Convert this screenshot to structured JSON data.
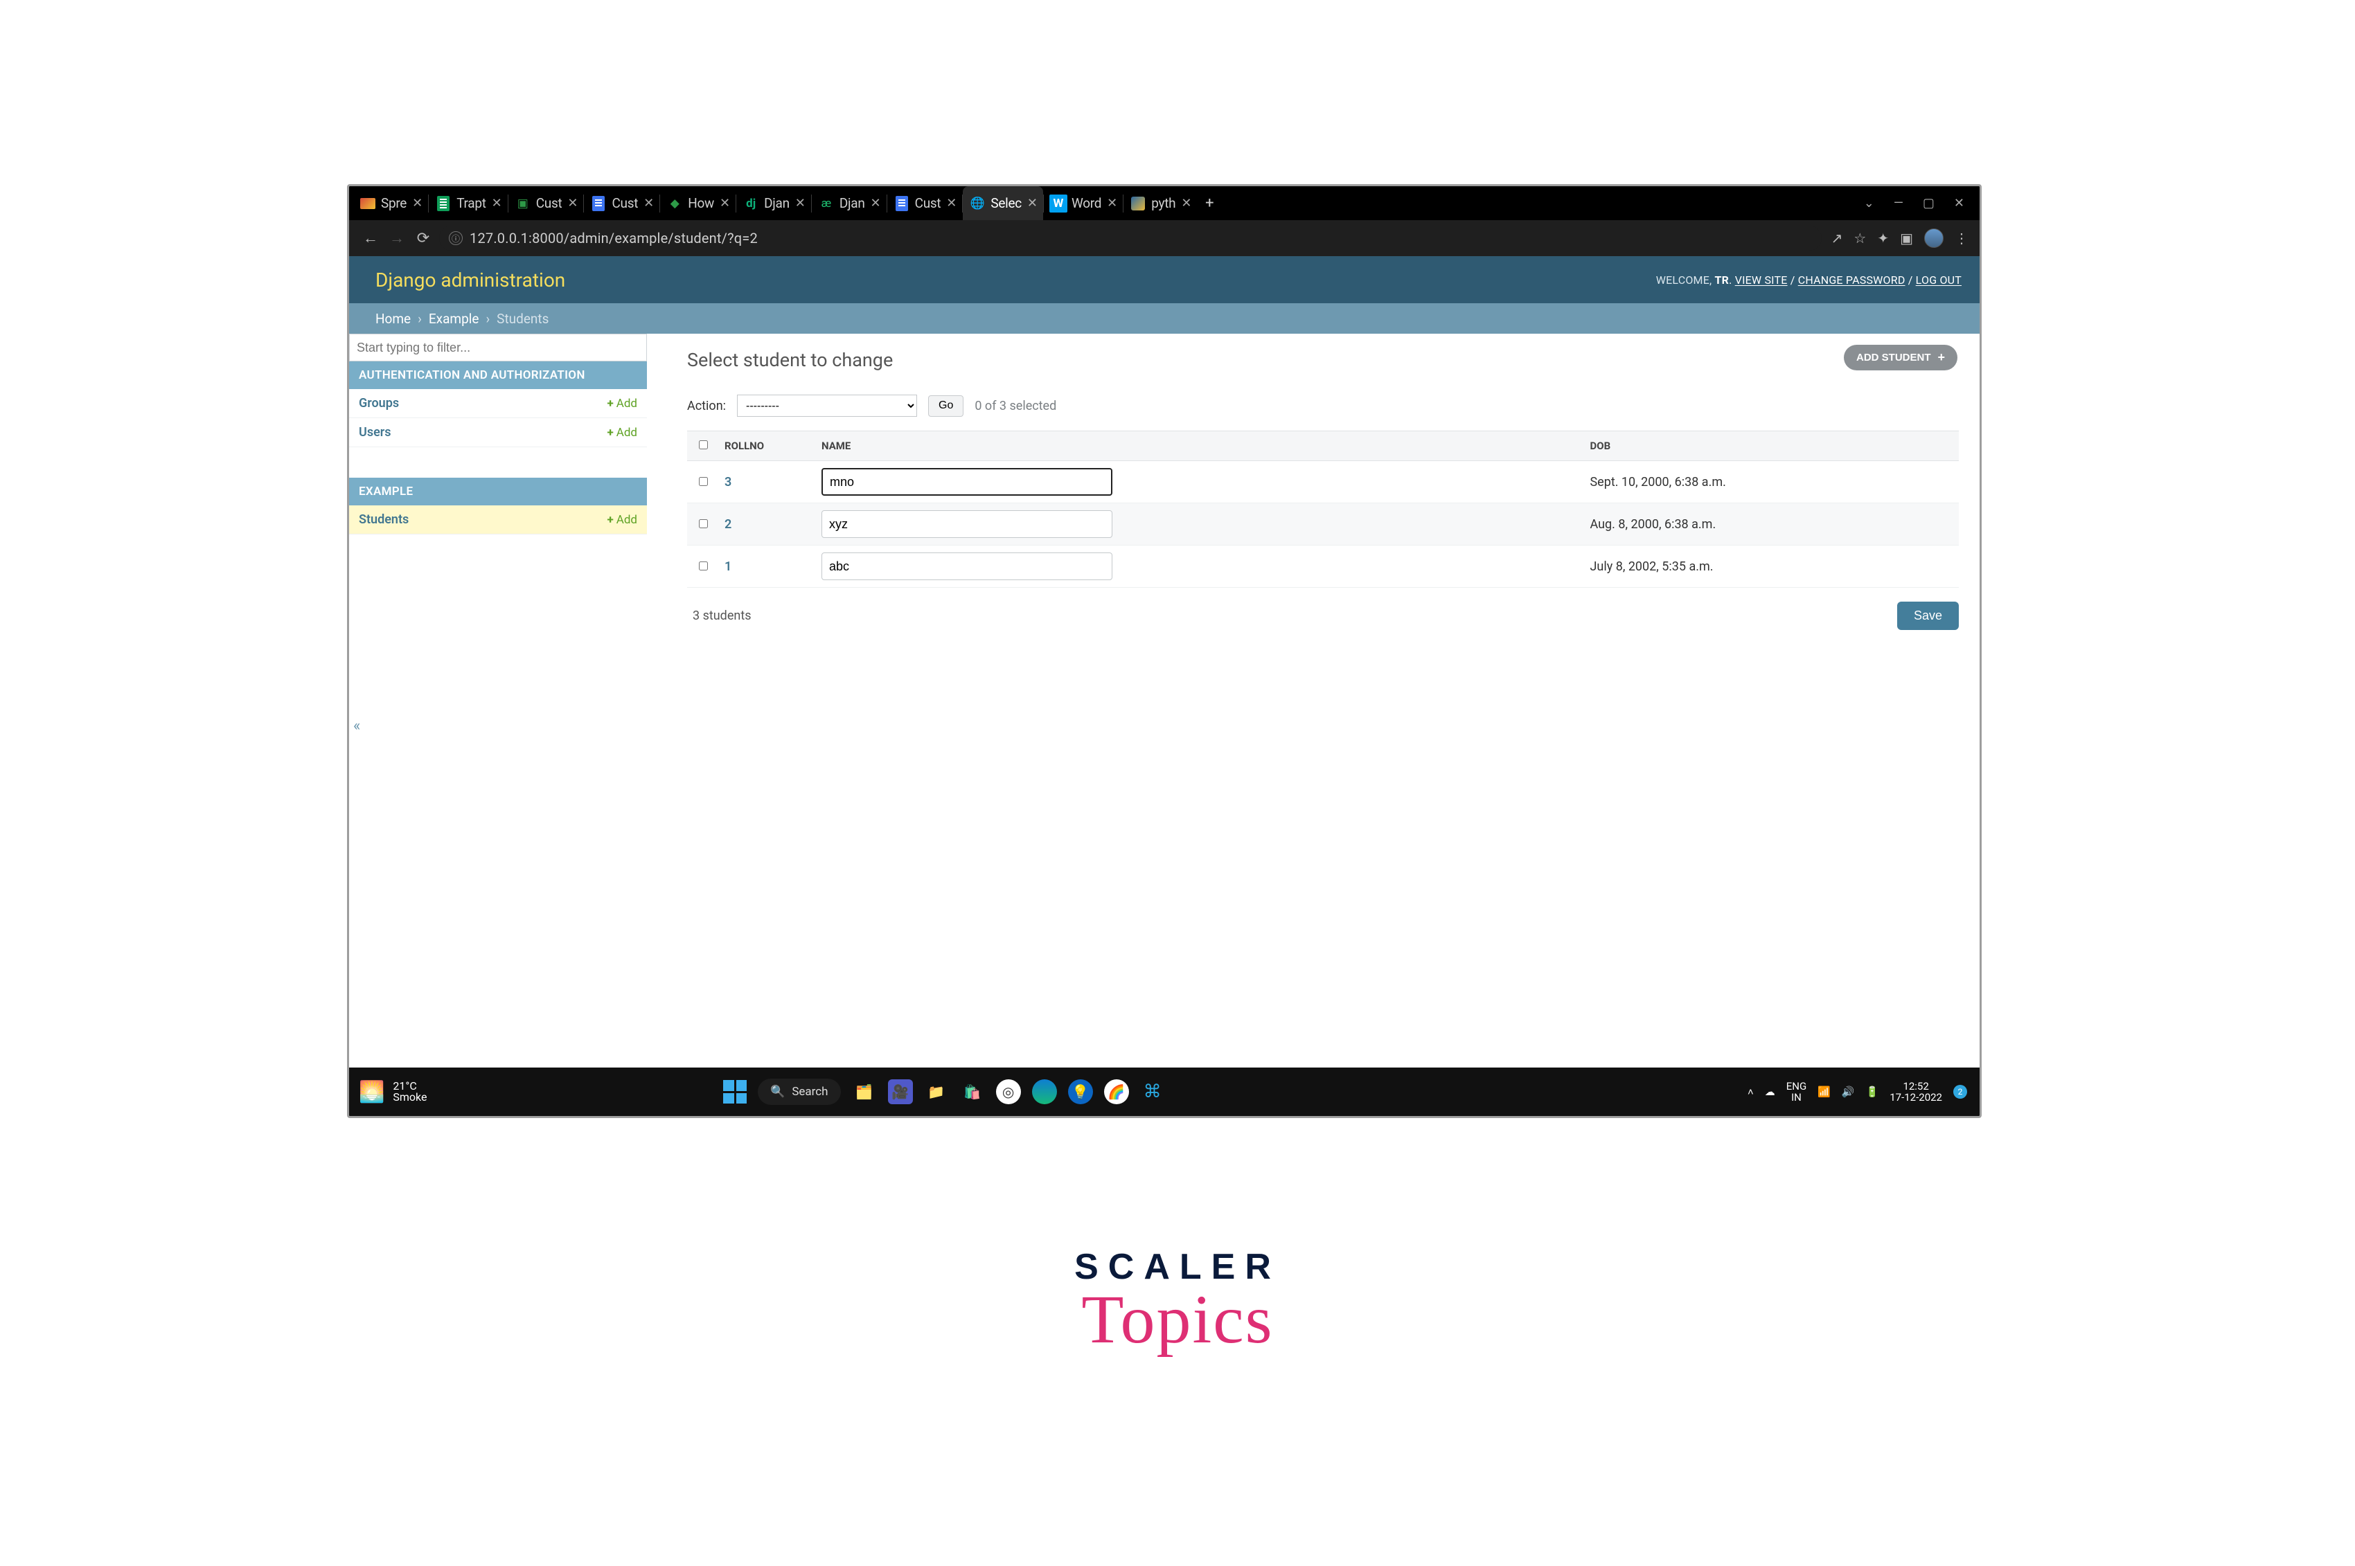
{
  "window": {
    "minimize": "—",
    "maximize": "▢",
    "close": "✕",
    "chevron": "⌄"
  },
  "tabs": [
    {
      "label": "Spre",
      "fav": "gmail"
    },
    {
      "label": "Trapt",
      "fav": "sheet"
    },
    {
      "label": "Cust",
      "fav": "drive"
    },
    {
      "label": "Cust",
      "fav": "doc"
    },
    {
      "label": "How",
      "fav": "drive"
    },
    {
      "label": "Djan",
      "fav": "dj"
    },
    {
      "label": "Djan",
      "fav": "djg"
    },
    {
      "label": "Cust",
      "fav": "doc"
    },
    {
      "label": "Selec",
      "fav": "globe",
      "active": true
    },
    {
      "label": "Word",
      "fav": "w"
    },
    {
      "label": "pyth",
      "fav": "py"
    }
  ],
  "newtab": "+",
  "addr": {
    "back": "←",
    "fwd": "→",
    "reload": "⟳",
    "globe": "ⓘ",
    "url": "127.0.0.1:8000/admin/example/student/?q=2",
    "share": "↗",
    "star": "☆",
    "ext": "✦",
    "box": "▣",
    "menu": "⋮"
  },
  "admin": {
    "brand": "Django administration",
    "welcome": "WELCOME, ",
    "username": "TR",
    "view_site": "VIEW SITE",
    "change_password": "CHANGE PASSWORD",
    "logout": "LOG OUT",
    "sep": " / "
  },
  "crumbs": {
    "home": "Home",
    "sep": "›",
    "app": "Example",
    "model": "Students"
  },
  "sidebar": {
    "filter_placeholder": "Start typing to filter...",
    "sec1": "AUTHENTICATION AND AUTHORIZATION",
    "sec2": "EXAMPLE",
    "groups": "Groups",
    "users": "Users",
    "students": "Students",
    "add": "Add",
    "plus": "+",
    "collapse": "«"
  },
  "page": {
    "title": "Select student to change",
    "add_btn": "ADD STUDENT",
    "plus": "+",
    "action_label": "Action:",
    "action_placeholder": "---------",
    "go": "Go",
    "sel_count": "0 of 3 selected",
    "columns": {
      "rollno": "ROLLNO",
      "name": "NAME",
      "dob": "DOB"
    },
    "rows": [
      {
        "rollno": "3",
        "name": "mno",
        "dob": "Sept. 10, 2000, 6:38 a.m.",
        "focused": true
      },
      {
        "rollno": "2",
        "name": "xyz",
        "dob": "Aug. 8, 2000, 6:38 a.m."
      },
      {
        "rollno": "1",
        "name": "abc",
        "dob": "July 8, 2002, 5:35 a.m."
      }
    ],
    "count": "3 students",
    "save": "Save"
  },
  "taskbar": {
    "temp": "21°C",
    "cond": "Smoke",
    "search_label": "Search",
    "search_icon": "🔍",
    "lang1": "ENG",
    "lang2": "IN",
    "time": "12:52",
    "date": "17-12-2022",
    "noti": "2",
    "up": "˄",
    "cloud": "☁",
    "wifi": "📶",
    "vol": "🔊",
    "bat": "🔋"
  },
  "brandmark": {
    "scaler": "SCALER",
    "topics": "Topics"
  }
}
